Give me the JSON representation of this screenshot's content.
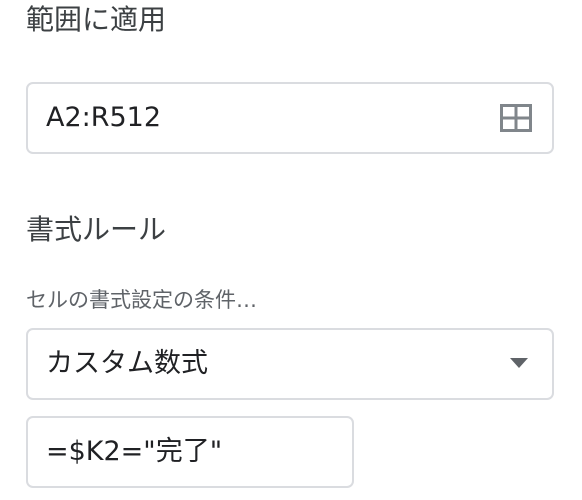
{
  "range_section": {
    "title": "範囲に適用",
    "value": "A2:R512",
    "icon": "grid-icon"
  },
  "rules_section": {
    "title": "書式ルール",
    "condition_label": "セルの書式設定の条件…",
    "condition_value": "カスタム数式",
    "dropdown_icon": "caret-down-icon",
    "formula_value": "=$K2=\"完了\""
  }
}
